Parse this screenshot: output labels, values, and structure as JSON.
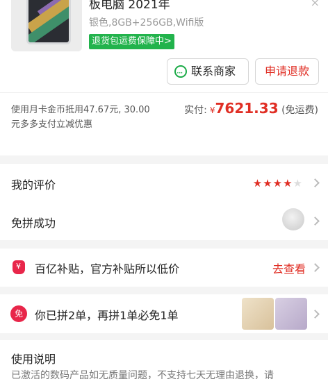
{
  "order": {
    "title": "板电脑 2021年",
    "spec": "银色,8GB+256GB,Wifi版",
    "badge": "退货包运费保障中>",
    "close_label": "×"
  },
  "actions": {
    "contact_label": "联系商家",
    "refund_label": "申请退款"
  },
  "payment": {
    "coupon_text": "使用月卡金币抵用47.67元, 30.00元多多支付立减优惠",
    "paid_label": "实付:",
    "currency": "¥",
    "amount": "7621.33",
    "shipping": "(免运费)"
  },
  "review": {
    "label": "我的评价",
    "rating": 4,
    "max": 5
  },
  "group": {
    "label": "免拼成功"
  },
  "subsidy": {
    "icon": "bag-icon",
    "text": "百亿补贴，官方补贴所以低价",
    "link": "去查看"
  },
  "free_order": {
    "icon_text": "免",
    "text": "你已拼2单，再拼1单必免1单"
  },
  "usage": {
    "heading": "使用说明",
    "text": "已激活的数码产品如无质量问题，不支持七天无理由退换，请"
  },
  "colors": {
    "accent": "#e02e24",
    "badge": "#22b34c",
    "contact_icon": "#1aaa46"
  }
}
